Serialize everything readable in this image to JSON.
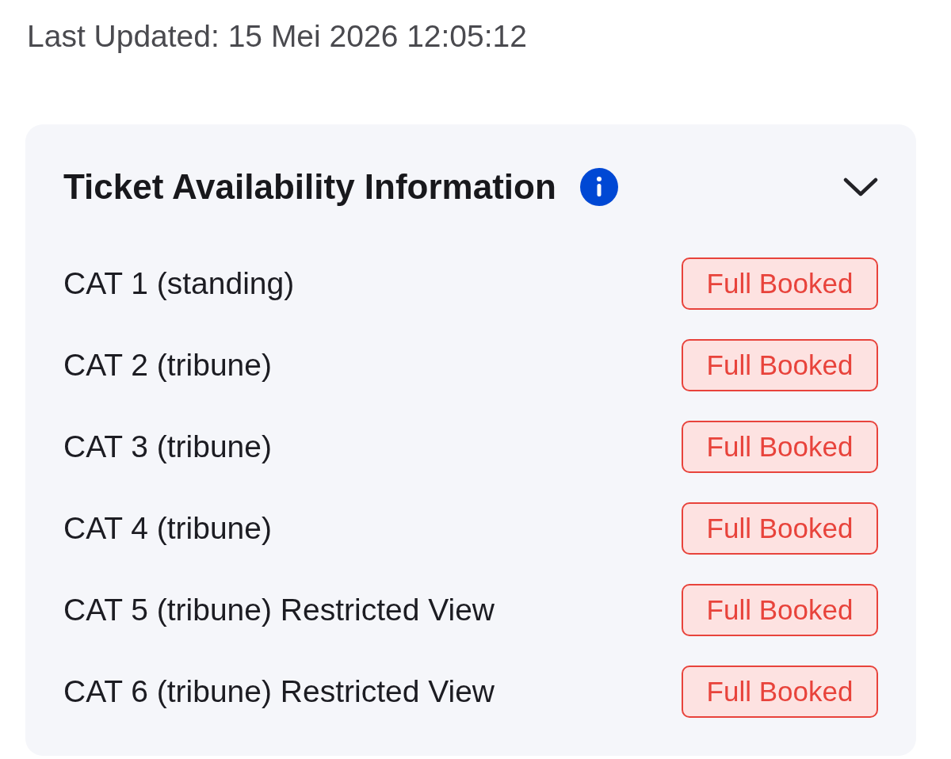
{
  "last_updated": "Last Updated: 15 Mei 2026 12:05:12",
  "panel": {
    "title": "Ticket Availability Information",
    "expanded": true,
    "categories": [
      {
        "name": "CAT 1 (standing)",
        "status": "Full Booked"
      },
      {
        "name": "CAT 2 (tribune)",
        "status": "Full Booked"
      },
      {
        "name": "CAT 3 (tribune)",
        "status": "Full Booked"
      },
      {
        "name": "CAT 4 (tribune)",
        "status": "Full Booked"
      },
      {
        "name": "CAT 5 (tribune) Restricted View",
        "status": "Full Booked"
      },
      {
        "name": "CAT 6 (tribune) Restricted View",
        "status": "Full Booked"
      }
    ]
  }
}
